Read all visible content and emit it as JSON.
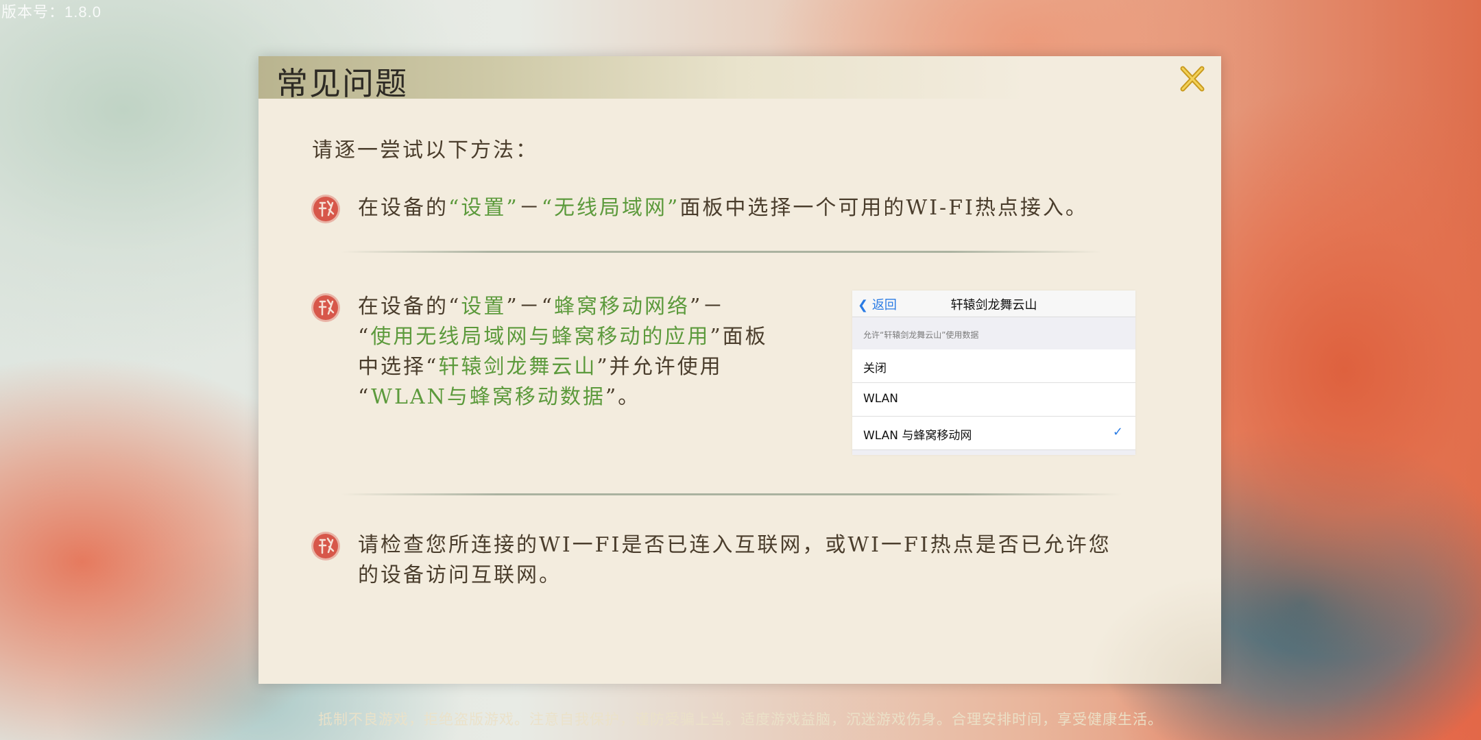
{
  "version_text": "版本号：1.8.0",
  "dialog": {
    "title": "常见问题",
    "intro": "请逐一尝试以下方法："
  },
  "items": [
    {
      "segments": [
        "在设备的",
        "“设置”",
        "－",
        "“无线局域网”",
        "面板中选择一个可用的WI-FI热点接入。"
      ]
    },
    {
      "lines": [
        [
          "在设备的“",
          "设置",
          "”－“",
          "蜂窝移动网络",
          "”－"
        ],
        [
          "“",
          "使用无线局域网与蜂窝移动的应用",
          "”面板"
        ],
        [
          "中选择“",
          "轩辕剑龙舞云山",
          "”并允许使用"
        ],
        [
          "“",
          "WLAN与蜂窝移动数据",
          "”。"
        ]
      ]
    },
    {
      "lines": [
        "请检查您所连接的WI一FI是否已连入互联网，或WI一FI热点是否已允许您",
        "的设备访问互联网。"
      ]
    }
  ],
  "settings_shot": {
    "back_label": "返回",
    "nav_title": "轩辕剑龙舞云山",
    "caption": "允许“轩辕剑龙舞云山”使用数据",
    "options": [
      "关闭",
      "WLAN",
      "WLAN 与蜂窝移动网"
    ],
    "selected_index": 2
  },
  "footer_text": "抵制不良游戏，拒绝盗版游戏。注意自我保护，谨防受骗上当。适度游戏益脑，沉迷游戏伤身。合理安排时间，享受健康生活。",
  "colors": {
    "highlight": "#5c9a3c",
    "body_text": "#4a3d2c",
    "seal_red": "#c9453a",
    "ios_blue": "#2a7be4"
  }
}
